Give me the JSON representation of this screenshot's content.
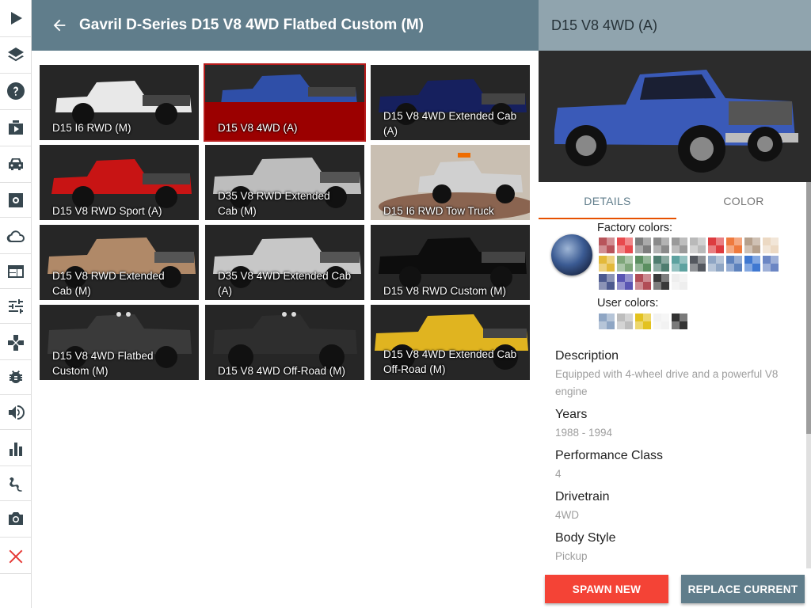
{
  "sidebar": {
    "items": [
      {
        "name": "play-icon"
      },
      {
        "name": "layers-icon"
      },
      {
        "name": "help-icon"
      },
      {
        "name": "scenario-icon"
      },
      {
        "name": "car-icon"
      },
      {
        "name": "parts-icon"
      },
      {
        "name": "cloud-icon"
      },
      {
        "name": "window-icon"
      },
      {
        "name": "tune-icon"
      },
      {
        "name": "gamepad-icon"
      },
      {
        "name": "bug-icon"
      },
      {
        "name": "sound-icon"
      },
      {
        "name": "chart-icon"
      },
      {
        "name": "path-icon"
      },
      {
        "name": "camera-icon"
      },
      {
        "name": "close-icon"
      }
    ]
  },
  "list": {
    "title": "Gavril D-Series D15 V8 4WD Flatbed Custom (M)",
    "tiles": [
      {
        "label": "D15 I6 RWD (M)",
        "color": "#e8e8e8"
      },
      {
        "label": "D15 V8 4WD (A)",
        "color": "#2f4fa8",
        "selected": true
      },
      {
        "label": "D15 V8 4WD Extended Cab (A)",
        "color": "#16205e"
      },
      {
        "label": "D15 V8 RWD Sport (A)",
        "color": "#c81414"
      },
      {
        "label": "D35 V8 RWD Extended Cab (M)",
        "color": "#bdbdbd"
      },
      {
        "label": "D15 I6 RWD Tow Truck",
        "color": "#d0d0d0"
      },
      {
        "label": "D15 V8 RWD Extended Cab (M)",
        "color": "#b08968"
      },
      {
        "label": "D35 V8 4WD Extended Cab (A)",
        "color": "#c7c7c7"
      },
      {
        "label": "D15 V8 RWD Custom (M)",
        "color": "#0d0d0d"
      },
      {
        "label": "D15 V8 4WD Flatbed Custom (M)",
        "color": "#3a3a3a"
      },
      {
        "label": "D15 V8 4WD Off-Road (M)",
        "color": "#2e2e2e"
      },
      {
        "label": "D15 V8 4WD Extended Cab Off-Road (M)",
        "color": "#e0b420"
      }
    ]
  },
  "detail": {
    "title": "D15 V8 4WD (A)",
    "tabs": [
      {
        "label": "DETAILS",
        "active": true
      },
      {
        "label": "COLOR",
        "active": false
      }
    ],
    "factory_colors_label": "Factory colors:",
    "user_colors_label": "User colors:",
    "factory_colors": [
      "#b8545a",
      "#e84a4e",
      "#7d7d7d",
      "#8a8a8a",
      "#9a9a9a",
      "#b9b9b9",
      "#dd3b3f",
      "#ef7a3e",
      "#b5a08c",
      "#ecd9c3",
      "#e3b93a",
      "#7fa67a",
      "#5b8f61",
      "#4e7d6f",
      "#5da2a0",
      "#54585f",
      "#8fa6c4",
      "#5d82bd",
      "#3f78d1",
      "#6b86c4",
      "#4d5a8f",
      "#5a56b3",
      "#b14d56",
      "#3a3a3a",
      "#eeeeee"
    ],
    "user_colors": [
      "#8fa6c4",
      "#bdbdbd",
      "#e3c21f",
      "#f2f2f2",
      "#333333"
    ],
    "info": [
      {
        "title": "Description",
        "value": "Equipped with 4-wheel drive and a powerful V8 engine"
      },
      {
        "title": "Years",
        "value": "1988 - 1994"
      },
      {
        "title": "Performance Class",
        "value": "4"
      },
      {
        "title": "Drivetrain",
        "value": "4WD"
      },
      {
        "title": "Body Style",
        "value": "Pickup"
      }
    ],
    "spawn_label": "SPAWN NEW",
    "replace_label": "REPLACE CURRENT"
  }
}
